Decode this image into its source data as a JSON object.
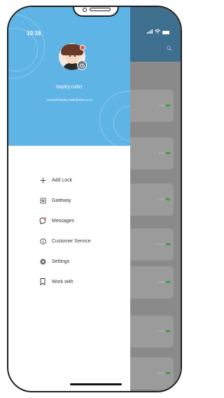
{
  "status": {
    "time": "10:16"
  },
  "profile": {
    "username": "hayley.rutter",
    "account": "Account:hayley.rutter@eira.co.nz"
  },
  "menu": {
    "items": [
      {
        "label": "Add Lock",
        "icon": "plus-icon"
      },
      {
        "label": "Gateway",
        "icon": "gateway-icon"
      },
      {
        "label": "Messages",
        "icon": "message-icon"
      },
      {
        "label": "Customer Service",
        "icon": "info-icon"
      },
      {
        "label": "Settings",
        "icon": "gear-icon"
      },
      {
        "label": "Work with",
        "icon": "bookmark-icon"
      }
    ]
  },
  "background_list": {
    "partial_text": "olt",
    "battery": [
      "35%",
      "85%",
      "80%",
      "100%",
      "60%",
      "100%",
      "100%"
    ]
  },
  "colors": {
    "drawer_header": "#5fb4e6",
    "overlay": "#8a8a8a",
    "battery_ok": "#3aa03a",
    "notification": "#e25b3b"
  }
}
